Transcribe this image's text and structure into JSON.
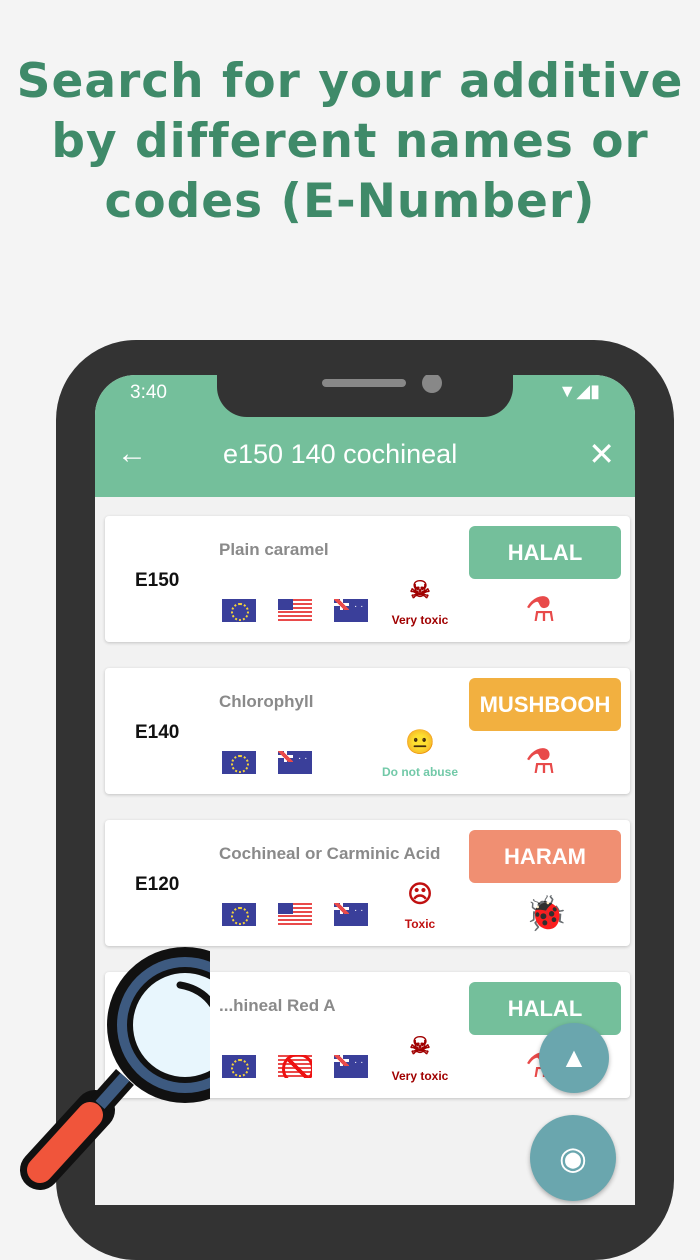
{
  "headline": [
    "Search for your additive",
    "by different names or",
    "codes (E-Number)"
  ],
  "status_bar": {
    "time": "3:40"
  },
  "search": {
    "query": "e150 140 cochineal"
  },
  "colors": {
    "halal": "#74bf9b",
    "mushbooh": "#f2b040",
    "haram": "#f08f72",
    "very_toxic": "#a00000",
    "do_not_abuse": "#72c9a8",
    "toxic": "#c01010"
  },
  "results": [
    {
      "code": "E150",
      "name": "Plain caramel",
      "flags": [
        "eu",
        "us",
        "au"
      ],
      "toxicity": "Very toxic",
      "tox_icon": "skull-icon",
      "status": "HALAL",
      "status_color": "#74bf9b",
      "origin_icon": "flask-icon"
    },
    {
      "code": "E140",
      "name": "Chlorophyll",
      "flags": [
        "eu",
        "au"
      ],
      "toxicity": "Do not abuse",
      "tox_icon": "neutral-face-icon",
      "status": "MUSHBOOH",
      "status_color": "#f2b040",
      "origin_icon": "flask-icon"
    },
    {
      "code": "E120",
      "name": "Cochineal or Carminic Acid",
      "flags": [
        "eu",
        "us",
        "au"
      ],
      "toxicity": "Toxic",
      "tox_icon": "sad-face-icon",
      "status": "HARAM",
      "status_color": "#f08f72",
      "origin_icon": "ladybug-icon"
    },
    {
      "code": "",
      "name": "...hineal Red A",
      "flags": [
        "eu",
        "us-banned",
        "au"
      ],
      "toxicity": "Very toxic",
      "tox_icon": "skull-icon",
      "status": "HALAL",
      "status_color": "#74bf9b",
      "origin_icon": "flask-icon"
    }
  ]
}
